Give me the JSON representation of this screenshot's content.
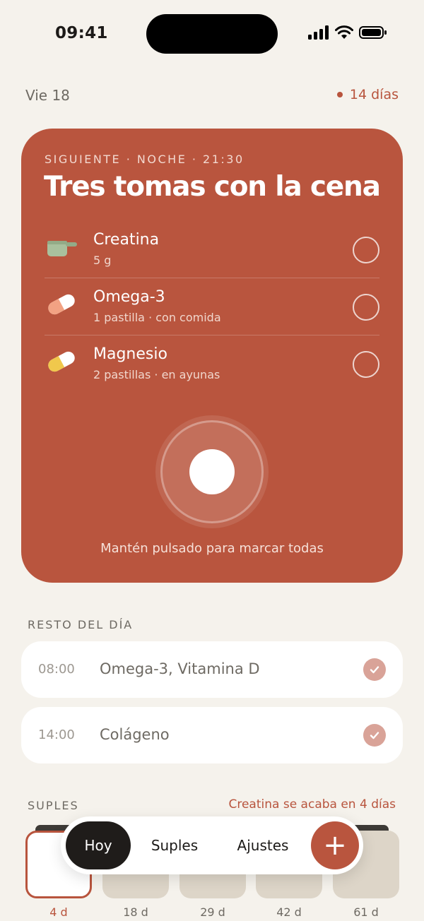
{
  "status": {
    "time": "09:41"
  },
  "header": {
    "date": "Vie 18",
    "streak": "14 días"
  },
  "next": {
    "kicker": "SIGUIENTE · NOCHE · 21:30",
    "title": "Tres tomas con la cena",
    "items": [
      {
        "name": "Creatina",
        "detail": "5 g",
        "icon": "scoop-icon"
      },
      {
        "name": "Omega-3",
        "detail": "1 pastilla · con comida",
        "icon": "pill-orange-icon"
      },
      {
        "name": "Magnesio",
        "detail": "2 pastillas · en ayunas",
        "icon": "pill-yellow-icon"
      }
    ],
    "hold_hint": "Mantén pulsado para marcar todas"
  },
  "rest": {
    "label": "RESTO DEL DÍA",
    "rows": [
      {
        "time": "08:00",
        "name": "Omega-3, Vitamina D"
      },
      {
        "time": "14:00",
        "name": "Colágeno"
      }
    ]
  },
  "supplements": {
    "label": "SUPLES",
    "warning": "Creatina se acaba en 4 días",
    "stock": [
      "4 d",
      "18 d",
      "29 d",
      "42 d",
      "61 d"
    ]
  },
  "tabs": {
    "today": "Hoy",
    "supplements": "Suples",
    "settings": "Ajustes",
    "add": "+"
  },
  "colors": {
    "accent": "#b9553e",
    "background": "#f5f2ec"
  }
}
